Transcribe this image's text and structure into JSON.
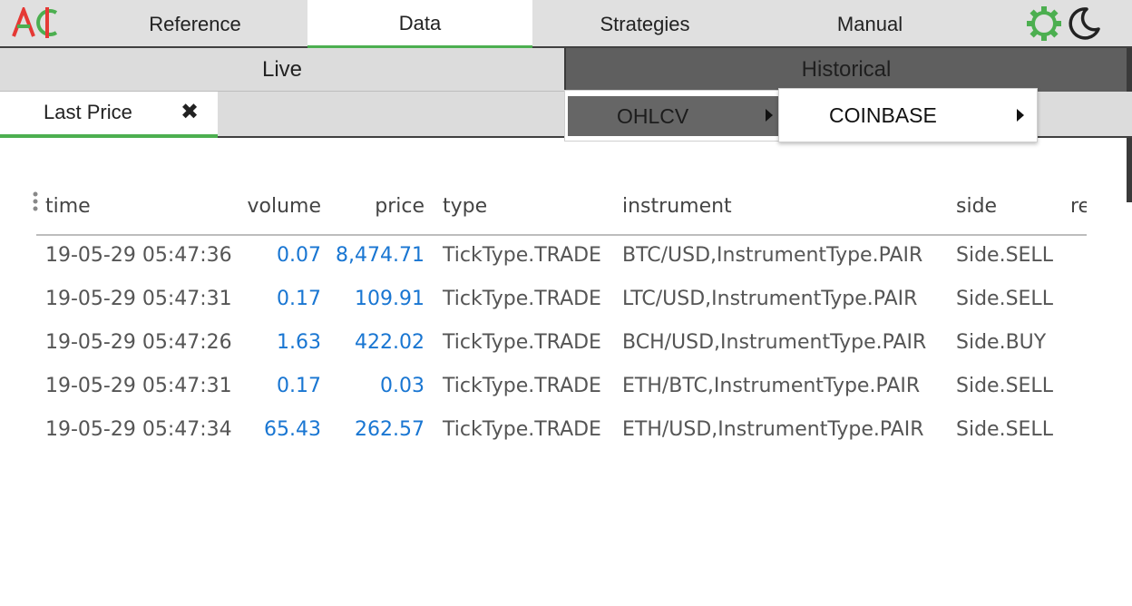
{
  "colors": {
    "accent_green": "#4caf50",
    "number_blue": "#1976d2",
    "nav_bg": "#e0e0e0",
    "historical_bg": "#5f5f5f"
  },
  "logo": {
    "icon": "app-logo-icon",
    "colors": [
      "#e53935",
      "#4caf50"
    ]
  },
  "nav": {
    "tabs": [
      {
        "label": "Reference",
        "active": false
      },
      {
        "label": "Data",
        "active": true
      },
      {
        "label": "Strategies",
        "active": false
      },
      {
        "label": "Manual",
        "active": false
      }
    ],
    "icons": [
      "gear-icon",
      "moon-icon"
    ]
  },
  "subnav": {
    "live_label": "Live",
    "historical_label": "Historical"
  },
  "panel_tab": {
    "label": "Last Price",
    "close_icon": "close-icon",
    "close_glyph": "✖"
  },
  "menus": {
    "level1": {
      "label": "OHLCV",
      "icon": "chevron-right-icon"
    },
    "level2": {
      "label": "COINBASE",
      "icon": "chevron-right-icon"
    }
  },
  "table": {
    "columns": [
      "time",
      "volume",
      "price",
      "type",
      "instrument",
      "side",
      "re"
    ],
    "rows": [
      {
        "time": "19-05-29 05:47:36",
        "volume": "0.07",
        "price": "8,474.71",
        "type": "TickType.TRADE",
        "instrument": "BTC/USD,InstrumentType.PAIR",
        "side": "Side.SELL"
      },
      {
        "time": "19-05-29 05:47:31",
        "volume": "0.17",
        "price": "109.91",
        "type": "TickType.TRADE",
        "instrument": "LTC/USD,InstrumentType.PAIR",
        "side": "Side.SELL"
      },
      {
        "time": "19-05-29 05:47:26",
        "volume": "1.63",
        "price": "422.02",
        "type": "TickType.TRADE",
        "instrument": "BCH/USD,InstrumentType.PAIR",
        "side": "Side.BUY"
      },
      {
        "time": "19-05-29 05:47:31",
        "volume": "0.17",
        "price": "0.03",
        "type": "TickType.TRADE",
        "instrument": "ETH/BTC,InstrumentType.PAIR",
        "side": "Side.SELL"
      },
      {
        "time": "19-05-29 05:47:34",
        "volume": "65.43",
        "price": "262.57",
        "type": "TickType.TRADE",
        "instrument": "ETH/USD,InstrumentType.PAIR",
        "side": "Side.SELL"
      }
    ]
  }
}
